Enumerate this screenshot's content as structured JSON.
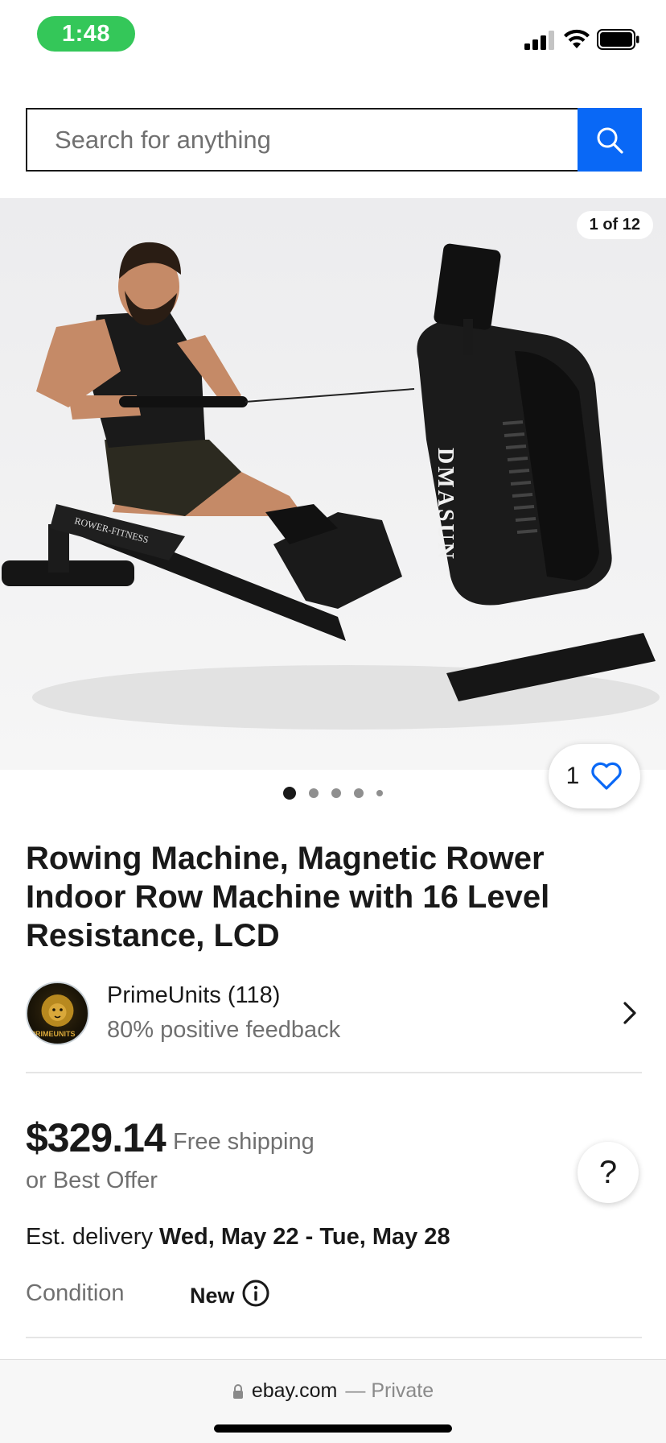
{
  "status": {
    "time": "1:48"
  },
  "search": {
    "placeholder": "Search for anything"
  },
  "gallery": {
    "counter": "1 of 12",
    "watch_count": "1",
    "dots": 5
  },
  "product": {
    "title": "Rowing Machine,  Magnetic Rower Indoor Row Machine with 16 Level Resistance, LCD",
    "brand_text": "DMASUN",
    "seat_text": "ROWER-FITNESS"
  },
  "seller": {
    "name": "PrimeUnits (118)",
    "feedback": "80% positive feedback",
    "avatar_text": "PRIMEUNITS"
  },
  "pricing": {
    "price": "$329.14",
    "shipping": "Free shipping",
    "best_offer": "or Best Offer",
    "help": "?"
  },
  "delivery": {
    "prefix": "Est. delivery",
    "dates": "Wed, May 22 - Tue, May 28"
  },
  "condition": {
    "label": "Condition",
    "value": "New"
  },
  "browser": {
    "domain": "ebay.com",
    "mode": "— Private"
  },
  "colors": {
    "accent": "#0968f6",
    "time_pill": "#34c759",
    "text": "#191919",
    "muted": "#707070"
  }
}
